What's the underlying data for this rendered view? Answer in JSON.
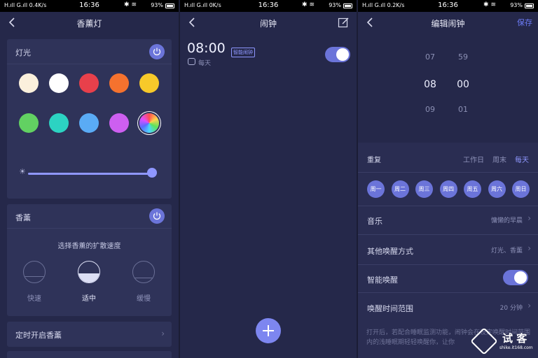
{
  "status_bars": [
    {
      "signal": "H.ıll G.ıll 0.4K/s",
      "time": "16:36",
      "battery": "93%"
    },
    {
      "signal": "H.ıll G.ıll 0K/s",
      "time": "16:36",
      "battery": "93%"
    },
    {
      "signal": "H.ıll G.ıll 0.2K/s",
      "time": "16:36",
      "battery": "93%"
    }
  ],
  "aroma_screen": {
    "title": "香薰灯",
    "light_card": {
      "title": "灯光",
      "swatches": [
        "#fbf0dc",
        "#ffffff",
        "#e8404b",
        "#f5722e",
        "#f7c92a",
        "#62d162",
        "#2cd3c2",
        "#5aabf5",
        "#cd5ff0",
        "rainbow"
      ],
      "brightness": 0.97
    },
    "scent_card": {
      "title": "香薰",
      "subtitle": "选择香薰的扩散速度",
      "speeds": [
        {
          "label": "快速",
          "selected": false
        },
        {
          "label": "适中",
          "selected": true
        },
        {
          "label": "缓慢",
          "selected": false
        }
      ]
    },
    "timer_row": {
      "label": "定时开启香薰"
    }
  },
  "alarm_screen": {
    "title": "闹钟",
    "alarms": [
      {
        "time": "08:00",
        "badge": "智能闹钟",
        "repeat": "每天",
        "enabled": true
      }
    ]
  },
  "edit_screen": {
    "title": "编辑闹钟",
    "save": "保存",
    "picker": {
      "hours": [
        "07",
        "08",
        "09"
      ],
      "minutes": [
        "59",
        "00",
        "01"
      ]
    },
    "repeat": {
      "label": "重复",
      "options": [
        {
          "label": "工作日",
          "active": false
        },
        {
          "label": "周末",
          "active": false
        },
        {
          "label": "每天",
          "active": true
        }
      ],
      "days": [
        "周一",
        "周二",
        "周三",
        "周四",
        "周五",
        "周六",
        "周日"
      ]
    },
    "music": {
      "label": "音乐",
      "value": "慵懒的早晨"
    },
    "other_wake": {
      "label": "其他唤醒方式",
      "value": "灯光、香薰"
    },
    "smart_wake": {
      "label": "智能唤醒",
      "enabled": true
    },
    "wake_range": {
      "label": "唤醒时间范围",
      "value": "20 分钟"
    },
    "note": "打开后，若配合睡眠监测功能，闹钟会在设定唤醒时间范围内的浅睡眠期轻轻唤醒你，让你",
    "watermark": {
      "text": "试 客",
      "sub": "shike.it168.com"
    }
  },
  "colors": {
    "accent": "#6b74d9",
    "bg": "#25284a",
    "card": "#2f3359",
    "link": "#6c7bf5"
  }
}
